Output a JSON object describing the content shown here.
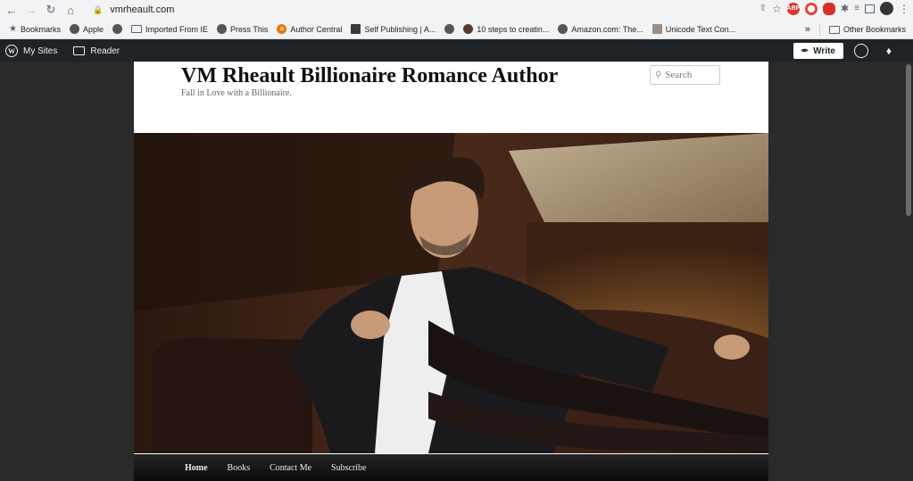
{
  "browser": {
    "url": "vmrheault.com",
    "bookmarks": [
      {
        "label": "Bookmarks",
        "icon": "star-icon"
      },
      {
        "label": "Apple",
        "icon": "globe-icon"
      },
      {
        "label": "",
        "icon": "globe-icon"
      },
      {
        "label": "Imported From IE",
        "icon": "folder-icon"
      },
      {
        "label": "Press This",
        "icon": "globe-icon"
      },
      {
        "label": "Author Central",
        "icon": "author-central-icon"
      },
      {
        "label": "Self Publishing | A...",
        "icon": "self-publishing-icon"
      },
      {
        "label": "",
        "icon": "globe-icon"
      },
      {
        "label": "10 steps to creatin...",
        "icon": "steps-icon"
      },
      {
        "label": "Amazon.com: The...",
        "icon": "globe-icon"
      },
      {
        "label": "Unicode Text Con...",
        "icon": "unicode-icon"
      }
    ],
    "overflow_label": "»",
    "other_bookmarks": "Other Bookmarks",
    "abp_badge": "ABP"
  },
  "wp_admin": {
    "my_sites": "My Sites",
    "reader": "Reader",
    "write": "Write"
  },
  "site": {
    "title": "VM Rheault Billionaire Romance Author",
    "tagline": "Fall in Love with a Billionaire.",
    "search_placeholder": "Search",
    "nav": [
      "Home",
      "Books",
      "Contact Me",
      "Subscribe"
    ]
  }
}
